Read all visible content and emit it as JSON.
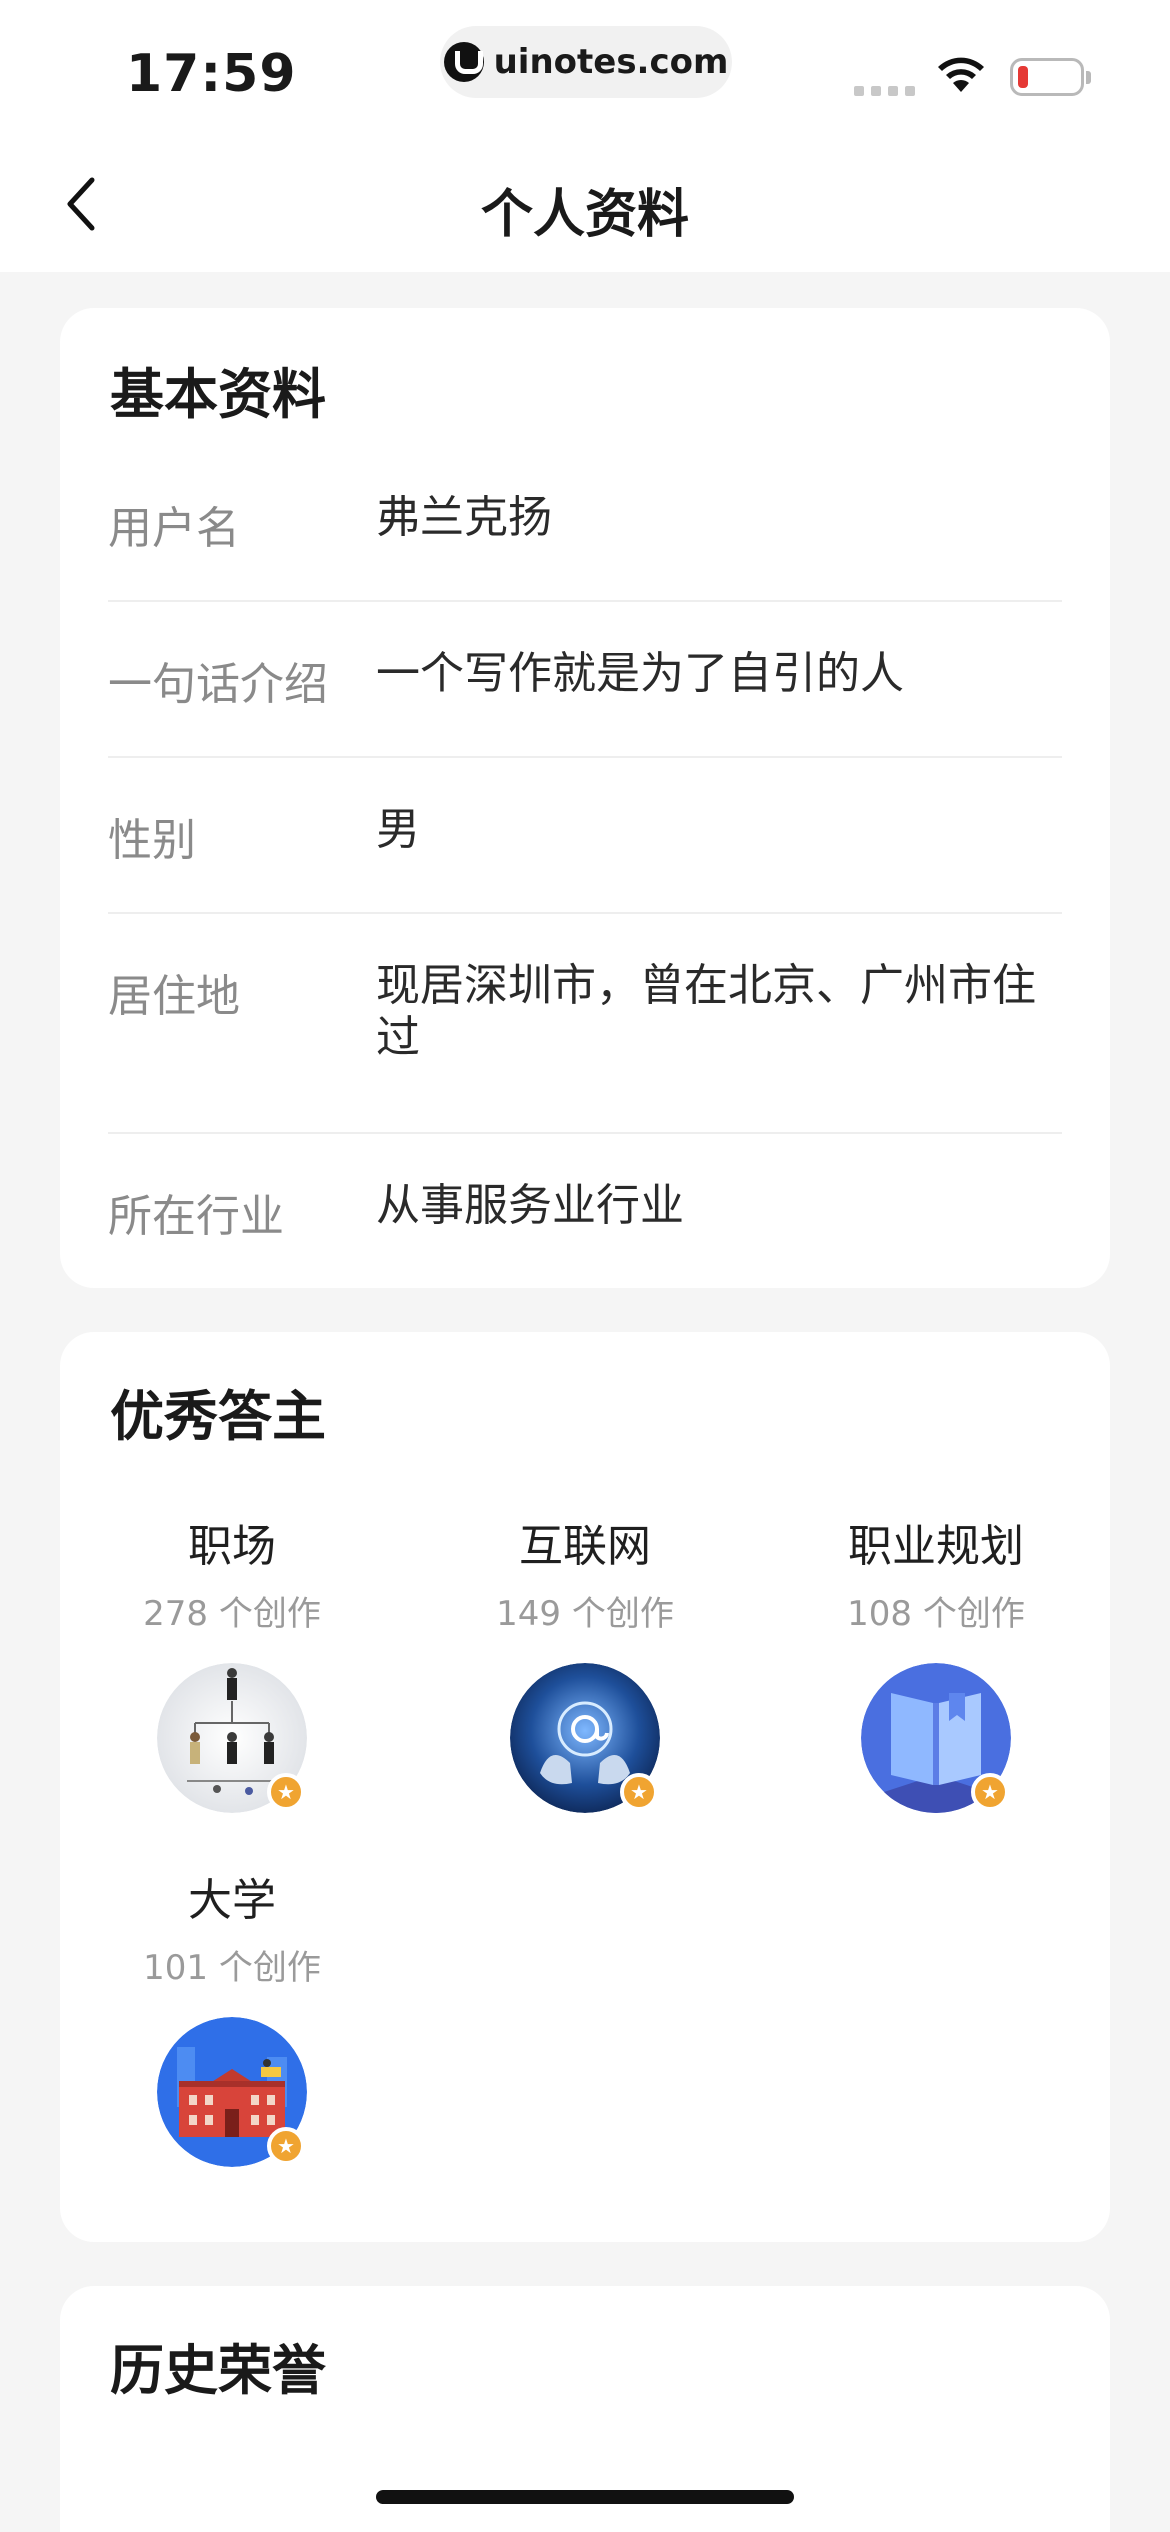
{
  "status_bar": {
    "time": "17:59",
    "url": "uinotes.com"
  },
  "nav": {
    "title": "个人资料"
  },
  "basic_info": {
    "title": "基本资料",
    "rows": [
      {
        "label": "用户名",
        "value": "弗兰克扬"
      },
      {
        "label": "一句话介绍",
        "value": "一个写作就是为了自引的人"
      },
      {
        "label": "性别",
        "value": "男"
      },
      {
        "label": "居住地",
        "value": "现居深圳市，曾在北京、广州市住过"
      },
      {
        "label": "所在行业",
        "value": "从事服务业行业"
      }
    ]
  },
  "excellent_answerer": {
    "title": "优秀答主",
    "topics": [
      {
        "name": "职场",
        "count": "278 个创作",
        "icon": "workplace-org-chart-icon"
      },
      {
        "name": "互联网",
        "count": "149 个创作",
        "icon": "internet-globe-icon"
      },
      {
        "name": "职业规划",
        "count": "108 个创作",
        "icon": "career-book-icon"
      },
      {
        "name": "大学",
        "count": "101 个创作",
        "icon": "university-building-icon"
      }
    ],
    "badge_icon": "star-badge-icon"
  },
  "history_honors": {
    "title": "历史荣誉"
  },
  "colors": {
    "background": "#f5f5f5",
    "card": "#ffffff",
    "label": "#8a8a8a",
    "badge": "#f0a431"
  }
}
